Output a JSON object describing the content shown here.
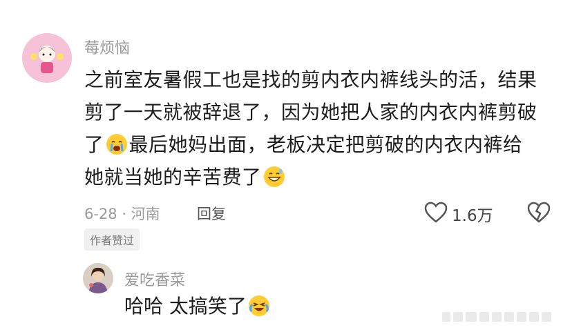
{
  "comment": {
    "username": "莓烦恼",
    "line1": "之前室友暑假工也是找的剪内衣内裤线头的活，结果",
    "line2": "剪了一天就被辞退了，因为她把人家的内衣内裤剪破",
    "line3_before": "了",
    "line3_after": "最后她妈出面，老板决定把剪破的内衣内裤给",
    "line4": "她就当她的辛苦费了",
    "meta": "6-28 · 河南",
    "reply_label": "回复",
    "like_count": "1.6万",
    "author_tag": "作者赞过"
  },
  "reply": {
    "username": "爱吃香菜",
    "text": "哈哈 太搞笑了"
  },
  "colors": {
    "muted_text": "#9a9a9a",
    "body_text": "#1c1c1c",
    "background": "#ffffff"
  },
  "icons": [
    "avatar-main",
    "crying-emoji-icon",
    "grin-sweat-emoji-icon",
    "heart-icon",
    "dislike-icon",
    "laugh-cry-emoji-icon"
  ]
}
